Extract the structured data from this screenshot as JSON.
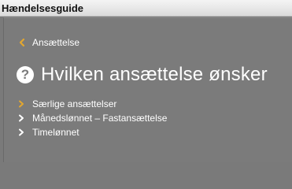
{
  "window": {
    "title": "Hændelsesguide"
  },
  "breadcrumb": {
    "back_label": "Ansættelse",
    "back_icon": "chevron-left-icon",
    "back_icon_color": "#e3a72f"
  },
  "question": {
    "icon": "question-circle-icon",
    "text": "Hvilken ansættelse ønsker"
  },
  "options": [
    {
      "label": "Særlige ansættelser",
      "icon": "chevron-right-icon",
      "icon_color": "#e3a72f"
    },
    {
      "label": "Månedslønnet – Fastansættelse",
      "icon": "chevron-right-icon",
      "icon_color": "#ffffff"
    },
    {
      "label": "Timelønnet",
      "icon": "chevron-right-icon",
      "icon_color": "#ffffff"
    }
  ],
  "colors": {
    "background": "#7b7b7b",
    "text": "#ffffff",
    "accent": "#e3a72f"
  }
}
